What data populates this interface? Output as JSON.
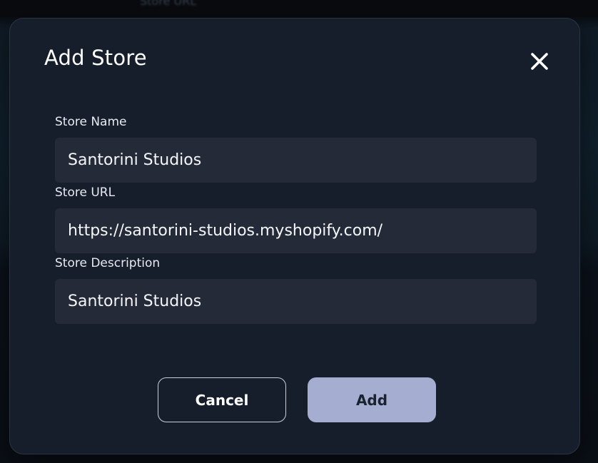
{
  "backdrop": {
    "ghost_label": "Store URL"
  },
  "modal": {
    "title": "Add Store",
    "close_icon": "close-icon",
    "fields": {
      "store_name": {
        "label": "Store Name",
        "value": "Santorini Studios"
      },
      "store_url": {
        "label": "Store URL",
        "value": "https://santorini-studios.myshopify.com/"
      },
      "store_description": {
        "label": "Store Description",
        "value": "Santorini Studios"
      }
    },
    "buttons": {
      "cancel": "Cancel",
      "add": "Add"
    }
  },
  "colors": {
    "modal_bg": "#161e2b",
    "input_bg": "#242a37",
    "add_button_bg": "#a5aed0",
    "text_primary": "#ffffff"
  }
}
